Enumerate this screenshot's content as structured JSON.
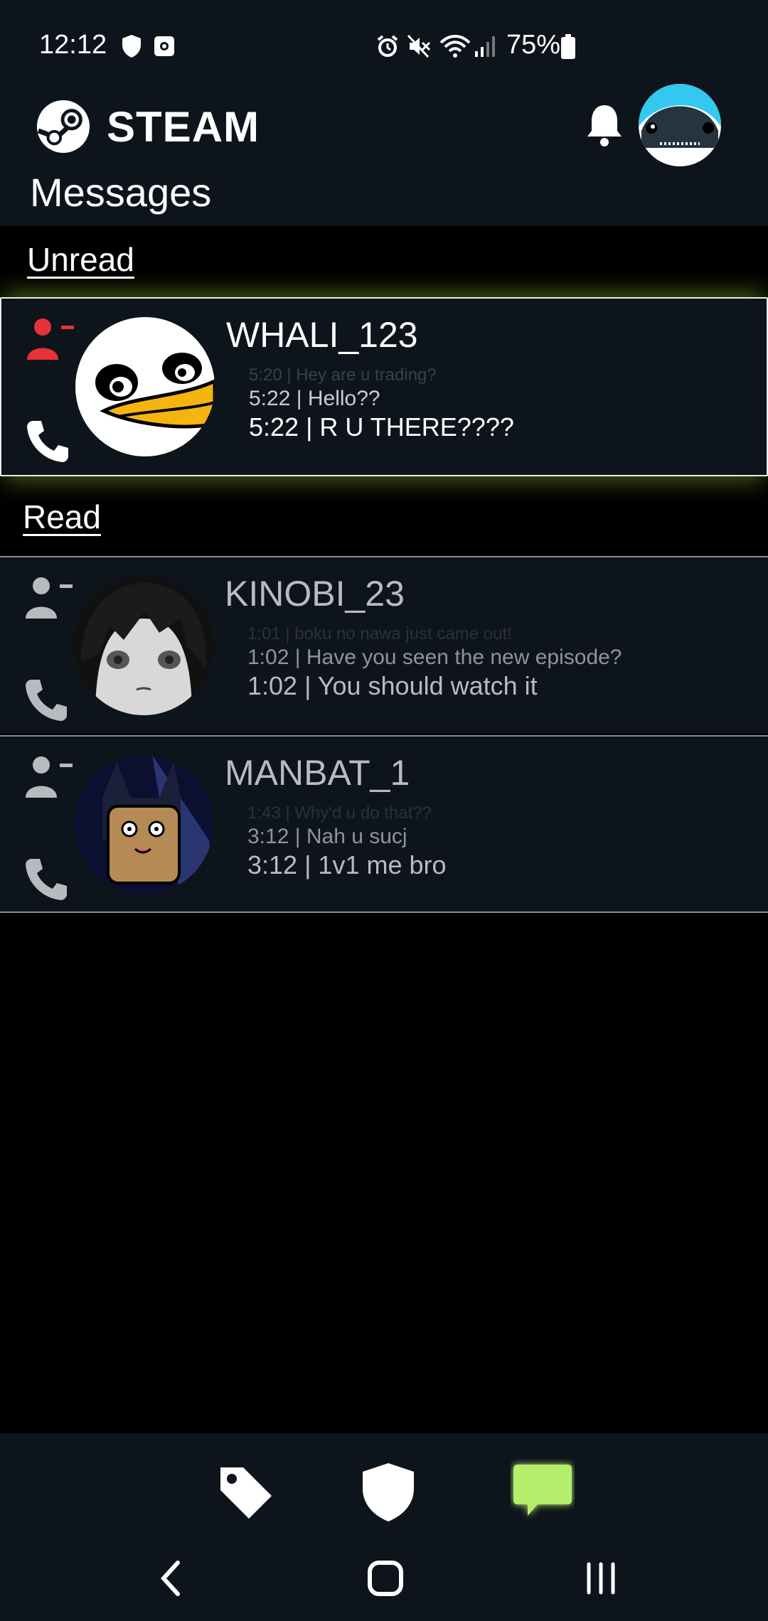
{
  "status_bar": {
    "time": "12:12",
    "battery": "75%"
  },
  "header": {
    "app_name": "STEAM",
    "title": "Messages"
  },
  "sections": {
    "unread": "Unread",
    "read": "Read"
  },
  "conversations": [
    {
      "username": "WHALI_123",
      "state": "unread",
      "messages": [
        "5:20 | Hey are u trading?",
        "5:22 | Hello??",
        "5:22 | R U THERE????"
      ]
    },
    {
      "username": "KINOBI_23",
      "state": "read",
      "messages": [
        "1:01 | boku no nawa just came out!",
        "1:02 | Have you seen the new episode?",
        "1:02 | You should watch it"
      ]
    },
    {
      "username": "MANBAT_1",
      "state": "read",
      "messages": [
        "1:43 | Why'd u do that??",
        "3:12 | Nah u sucj",
        "3:12 | 1v1 me bro"
      ]
    }
  ],
  "bottom_nav": [
    {
      "icon": "tag-icon",
      "active": false
    },
    {
      "icon": "shield-icon",
      "active": false
    },
    {
      "icon": "chat-icon",
      "active": true
    }
  ],
  "colors": {
    "accent": "#b5ee6c",
    "alert_red": "#e8323a",
    "bar_bg": "#0e141b",
    "read_icon": "#b7bbbf"
  }
}
